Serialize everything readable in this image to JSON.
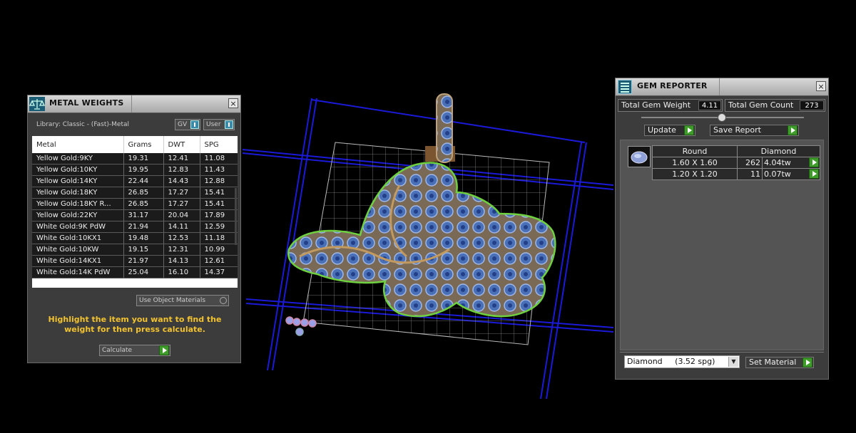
{
  "metal_weights": {
    "title": "METAL WEIGHTS",
    "library_label": "Library: Classic - (Fast)-Metal",
    "gv_label": "GV",
    "user_label": "User",
    "columns": [
      "Metal",
      "Grams",
      "DWT",
      "SPG"
    ],
    "rows": [
      [
        "Yellow Gold:9KY",
        "19.31",
        "12.41",
        "11.08"
      ],
      [
        "Yellow Gold:10KY",
        "19.95",
        "12.83",
        "11.43"
      ],
      [
        "Yellow Gold:14KY",
        "22.44",
        "14.43",
        "12.88"
      ],
      [
        "Yellow Gold:18KY",
        "26.85",
        "17.27",
        "15.41"
      ],
      [
        "Yellow Gold:18KY R...",
        "26.85",
        "17.27",
        "15.41"
      ],
      [
        "Yellow Gold:22KY",
        "31.17",
        "20.04",
        "17.89"
      ],
      [
        "White Gold:9K PdW",
        "21.94",
        "14.11",
        "12.59"
      ],
      [
        "White Gold:10KX1",
        "19.48",
        "12.53",
        "11.18"
      ],
      [
        "White Gold:10KW",
        "19.15",
        "12.31",
        "10.99"
      ],
      [
        "White Gold:14KX1",
        "21.97",
        "14.13",
        "12.61"
      ],
      [
        "White Gold:14K PdW",
        "25.04",
        "16.10",
        "14.37"
      ]
    ],
    "use_object_materials": "Use Object Materials",
    "instruction": "Highlight the item you want to find the weight for then press calculate.",
    "calculate_value": "Calculate"
  },
  "gem_reporter": {
    "title": "GEM REPORTER",
    "total_weight_label": "Total Gem Weight",
    "total_weight_value": "4.11",
    "total_count_label": "Total Gem Count",
    "total_count_value": "273",
    "update_label": "Update",
    "save_report_label": "Save Report",
    "table_headers": [
      "Round",
      "Diamond"
    ],
    "gem_rows": [
      {
        "size": "1.60 X 1.60",
        "count": "262",
        "weight": "4.04tw"
      },
      {
        "size": "1.20 X 1.20",
        "count": "11",
        "weight": "0.07tw"
      }
    ],
    "material_selected": "Diamond     (3.52 spg)",
    "set_material_label": "Set Material"
  },
  "colors": {
    "accent_green": "#3f9b2a",
    "instruction_yellow": "#f2c230",
    "grid_blue": "#1a1ad8"
  }
}
